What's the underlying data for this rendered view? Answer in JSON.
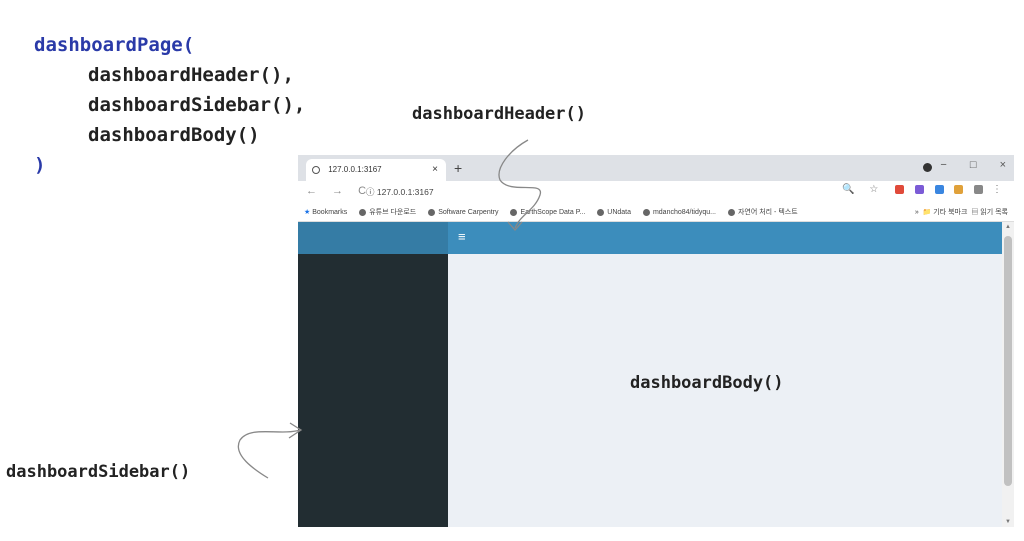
{
  "code": {
    "line1": "dashboardPage(",
    "line2": "dashboardHeader(),",
    "line3": "dashboardSidebar(),",
    "line4": "dashboardBody()",
    "line5": ")"
  },
  "labels": {
    "header": "dashboardHeader()",
    "sidebar": "dashboardSidebar()",
    "body": "dashboardBody()"
  },
  "browser": {
    "tab_title": "127.0.0.1:3167",
    "tab_close": "×",
    "new_tab": "+",
    "win_minimize": "−",
    "win_maximize": "□",
    "win_close": "×",
    "nav": "← → C",
    "url": "127.0.0.1:3167",
    "bookmarks": [
      "Bookmarks",
      "유튜브 다운로드",
      "Software Carpentry",
      "EarthScope Data P...",
      "UNdata",
      "mdancho84/tidyqu...",
      "자연어 처리 - 텍스트"
    ],
    "bookmarks_more": "»",
    "bookmarks_other": "기타 북마크",
    "bookmarks_reading": "읽기 목록"
  },
  "app": {
    "toggle_icon": "≡",
    "colors": {
      "logo": "#357ca5",
      "navbar": "#3c8dbc",
      "sidebar": "#222d32",
      "body": "#ecf0f5"
    }
  }
}
